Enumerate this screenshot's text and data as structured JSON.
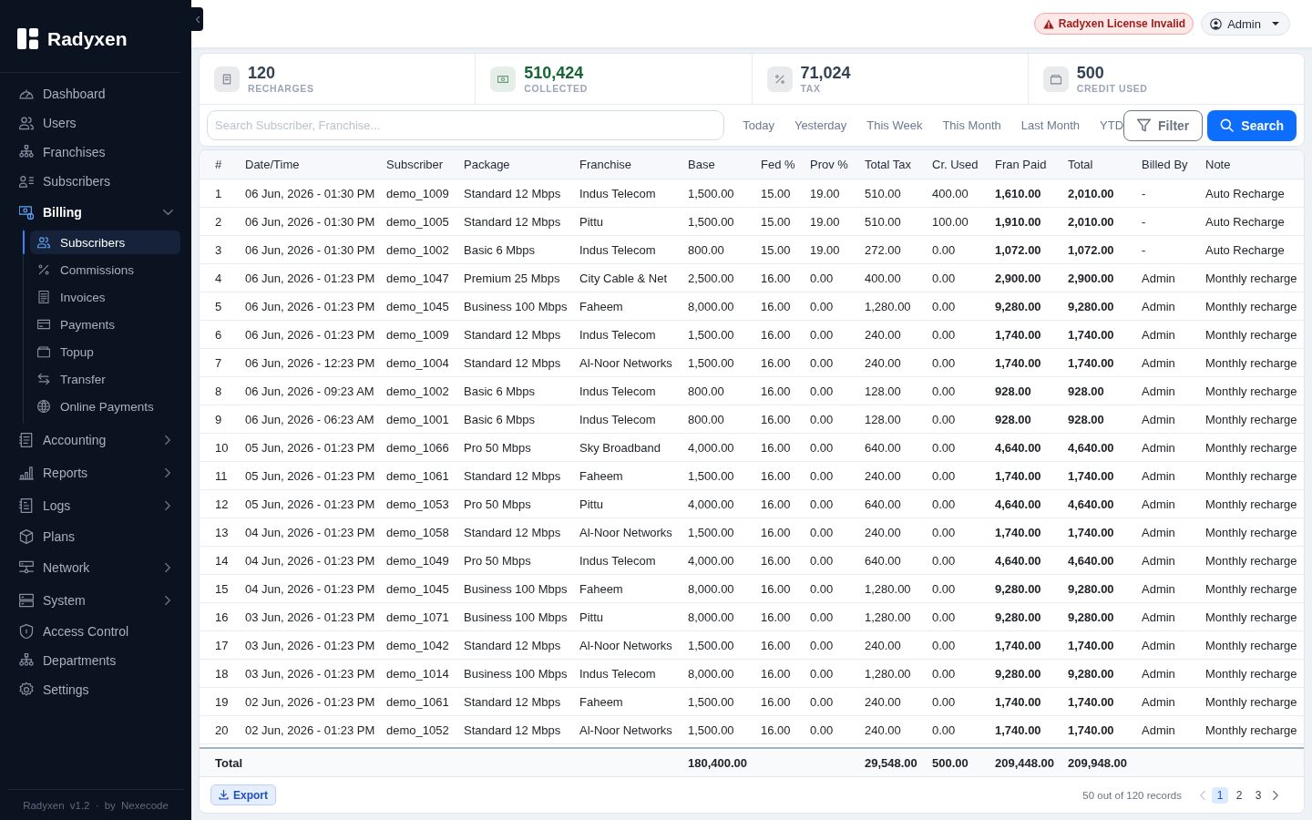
{
  "sidebar": {
    "brand": "Radyxen",
    "items": [
      {
        "label": "Dashboard",
        "kind": "link",
        "selected": false
      },
      {
        "label": "Users",
        "kind": "link",
        "selected": false
      },
      {
        "label": "Franchises",
        "kind": "link",
        "selected": false
      },
      {
        "label": "Subscribers",
        "kind": "link",
        "selected": false
      },
      {
        "label": "Billing",
        "kind": "group",
        "selected": true,
        "expanded": true,
        "children": [
          {
            "label": "Subscribers",
            "selected": true
          },
          {
            "label": "Commissions",
            "selected": false
          },
          {
            "label": "Invoices",
            "selected": false
          },
          {
            "label": "Payments",
            "selected": false
          },
          {
            "label": "Topup",
            "selected": false
          },
          {
            "label": "Transfer",
            "selected": false
          },
          {
            "label": "Online Payments",
            "selected": false
          }
        ]
      },
      {
        "label": "Accounting",
        "kind": "group",
        "selected": false,
        "expanded": false
      },
      {
        "label": "Reports",
        "kind": "group",
        "selected": false,
        "expanded": false
      },
      {
        "label": "Logs",
        "kind": "group",
        "selected": false,
        "expanded": false
      },
      {
        "label": "Plans",
        "kind": "link",
        "selected": false
      },
      {
        "label": "Network",
        "kind": "group",
        "selected": false,
        "expanded": false
      },
      {
        "label": "System",
        "kind": "group",
        "selected": false,
        "expanded": false
      },
      {
        "label": "Access Control",
        "kind": "link",
        "selected": false
      },
      {
        "label": "Departments",
        "kind": "link",
        "selected": false
      },
      {
        "label": "Settings",
        "kind": "link",
        "selected": false
      }
    ],
    "footer": "Radyxen v1.2 · by Nexecode"
  },
  "top_bar": {
    "alert": "Radyxen License Invalid",
    "user_menu": "Admin"
  },
  "stats": [
    {
      "value": "120",
      "label": "RECHARGES",
      "color": "#334155"
    },
    {
      "value": "510,424",
      "label": "COLLECTED",
      "color": "#166534"
    },
    {
      "value": "71,024",
      "label": "TAX",
      "color": "#334155"
    },
    {
      "value": "500",
      "label": "CREDIT USED",
      "color": "#334155"
    }
  ],
  "filters": {
    "search": {
      "placeholder": "Search Subscriber, Franchise..."
    },
    "date_ranges": [
      {
        "label": "Today",
        "selected": false
      },
      {
        "label": "Yesterday",
        "selected": false
      },
      {
        "label": "This Week",
        "selected": false
      },
      {
        "label": "This Month",
        "selected": false
      },
      {
        "label": "Last Month",
        "selected": false
      },
      {
        "label": "YTD",
        "selected": false
      }
    ],
    "filter_button": "Filter",
    "search_button": "Search"
  },
  "table": {
    "columns": [
      "#",
      "Date/Time",
      "Subscriber",
      "Package",
      "Franchise",
      "Base",
      "Fed %",
      "Prov %",
      "Total Tax",
      "Cr. Used",
      "Fran Paid",
      "Total",
      "Billed By",
      "Note"
    ],
    "rows": [
      [
        "1",
        "06 Jun, 2026 - 01:30 PM",
        "demo_1009",
        "Standard 12 Mbps",
        "Indus Telecom",
        "1,500.00",
        "15.00",
        "19.00",
        "510.00",
        "400.00",
        "1,610.00",
        "2,010.00",
        "-",
        "Auto Recharge"
      ],
      [
        "2",
        "06 Jun, 2026 - 01:30 PM",
        "demo_1005",
        "Standard 12 Mbps",
        "Pittu",
        "1,500.00",
        "15.00",
        "19.00",
        "510.00",
        "100.00",
        "1,910.00",
        "2,010.00",
        "-",
        "Auto Recharge"
      ],
      [
        "3",
        "06 Jun, 2026 - 01:30 PM",
        "demo_1002",
        "Basic 6 Mbps",
        "Indus Telecom",
        "800.00",
        "15.00",
        "19.00",
        "272.00",
        "0.00",
        "1,072.00",
        "1,072.00",
        "-",
        "Auto Recharge"
      ],
      [
        "4",
        "06 Jun, 2026 - 01:23 PM",
        "demo_1047",
        "Premium 25 Mbps",
        "City Cable & Net",
        "2,500.00",
        "16.00",
        "0.00",
        "400.00",
        "0.00",
        "2,900.00",
        "2,900.00",
        "Admin",
        "Monthly recharge"
      ],
      [
        "5",
        "06 Jun, 2026 - 01:23 PM",
        "demo_1045",
        "Business 100 Mbps",
        "Faheem",
        "8,000.00",
        "16.00",
        "0.00",
        "1,280.00",
        "0.00",
        "9,280.00",
        "9,280.00",
        "Admin",
        "Monthly recharge"
      ],
      [
        "6",
        "06 Jun, 2026 - 01:23 PM",
        "demo_1009",
        "Standard 12 Mbps",
        "Indus Telecom",
        "1,500.00",
        "16.00",
        "0.00",
        "240.00",
        "0.00",
        "1,740.00",
        "1,740.00",
        "Admin",
        "Monthly recharge"
      ],
      [
        "7",
        "06 Jun, 2026 - 12:23 PM",
        "demo_1004",
        "Standard 12 Mbps",
        "Al-Noor Networks",
        "1,500.00",
        "16.00",
        "0.00",
        "240.00",
        "0.00",
        "1,740.00",
        "1,740.00",
        "Admin",
        "Monthly recharge"
      ],
      [
        "8",
        "06 Jun, 2026 - 09:23 AM",
        "demo_1002",
        "Basic 6 Mbps",
        "Indus Telecom",
        "800.00",
        "16.00",
        "0.00",
        "128.00",
        "0.00",
        "928.00",
        "928.00",
        "Admin",
        "Monthly recharge"
      ],
      [
        "9",
        "06 Jun, 2026 - 06:23 AM",
        "demo_1001",
        "Basic 6 Mbps",
        "Indus Telecom",
        "800.00",
        "16.00",
        "0.00",
        "128.00",
        "0.00",
        "928.00",
        "928.00",
        "Admin",
        "Monthly recharge"
      ],
      [
        "10",
        "05 Jun, 2026 - 01:23 PM",
        "demo_1066",
        "Pro 50 Mbps",
        "Sky Broadband",
        "4,000.00",
        "16.00",
        "0.00",
        "640.00",
        "0.00",
        "4,640.00",
        "4,640.00",
        "Admin",
        "Monthly recharge"
      ],
      [
        "11",
        "05 Jun, 2026 - 01:23 PM",
        "demo_1061",
        "Standard 12 Mbps",
        "Faheem",
        "1,500.00",
        "16.00",
        "0.00",
        "240.00",
        "0.00",
        "1,740.00",
        "1,740.00",
        "Admin",
        "Monthly recharge"
      ],
      [
        "12",
        "05 Jun, 2026 - 01:23 PM",
        "demo_1053",
        "Pro 50 Mbps",
        "Pittu",
        "4,000.00",
        "16.00",
        "0.00",
        "640.00",
        "0.00",
        "4,640.00",
        "4,640.00",
        "Admin",
        "Monthly recharge"
      ],
      [
        "13",
        "04 Jun, 2026 - 01:23 PM",
        "demo_1058",
        "Standard 12 Mbps",
        "Al-Noor Networks",
        "1,500.00",
        "16.00",
        "0.00",
        "240.00",
        "0.00",
        "1,740.00",
        "1,740.00",
        "Admin",
        "Monthly recharge"
      ],
      [
        "14",
        "04 Jun, 2026 - 01:23 PM",
        "demo_1049",
        "Pro 50 Mbps",
        "Indus Telecom",
        "4,000.00",
        "16.00",
        "0.00",
        "640.00",
        "0.00",
        "4,640.00",
        "4,640.00",
        "Admin",
        "Monthly recharge"
      ],
      [
        "15",
        "04 Jun, 2026 - 01:23 PM",
        "demo_1045",
        "Business 100 Mbps",
        "Faheem",
        "8,000.00",
        "16.00",
        "0.00",
        "1,280.00",
        "0.00",
        "9,280.00",
        "9,280.00",
        "Admin",
        "Monthly recharge"
      ],
      [
        "16",
        "03 Jun, 2026 - 01:23 PM",
        "demo_1071",
        "Business 100 Mbps",
        "Pittu",
        "8,000.00",
        "16.00",
        "0.00",
        "1,280.00",
        "0.00",
        "9,280.00",
        "9,280.00",
        "Admin",
        "Monthly recharge"
      ],
      [
        "17",
        "03 Jun, 2026 - 01:23 PM",
        "demo_1042",
        "Standard 12 Mbps",
        "Al-Noor Networks",
        "1,500.00",
        "16.00",
        "0.00",
        "240.00",
        "0.00",
        "1,740.00",
        "1,740.00",
        "Admin",
        "Monthly recharge"
      ],
      [
        "18",
        "03 Jun, 2026 - 01:23 PM",
        "demo_1014",
        "Business 100 Mbps",
        "Indus Telecom",
        "8,000.00",
        "16.00",
        "0.00",
        "1,280.00",
        "0.00",
        "9,280.00",
        "9,280.00",
        "Admin",
        "Monthly recharge"
      ],
      [
        "19",
        "02 Jun, 2026 - 01:23 PM",
        "demo_1061",
        "Standard 12 Mbps",
        "Faheem",
        "1,500.00",
        "16.00",
        "0.00",
        "240.00",
        "0.00",
        "1,740.00",
        "1,740.00",
        "Admin",
        "Monthly recharge"
      ],
      [
        "20",
        "02 Jun, 2026 - 01:23 PM",
        "demo_1052",
        "Standard 12 Mbps",
        "Al-Noor Networks",
        "1,500.00",
        "16.00",
        "0.00",
        "240.00",
        "0.00",
        "1,740.00",
        "1,740.00",
        "Admin",
        "Monthly recharge"
      ]
    ],
    "totals": {
      "label": "Total",
      "base": "180,400.00",
      "total_tax": "29,548.00",
      "cr_used": "500.00",
      "fran_paid": "209,448.00",
      "total": "209,948.00"
    },
    "export_button": "Export",
    "pagination": {
      "summary": "50 out of 120 records",
      "previous_disabled": true,
      "next_disabled": false,
      "pages": [
        {
          "label": "1",
          "selected": true
        },
        {
          "label": "2",
          "selected": false
        },
        {
          "label": "3",
          "selected": false
        }
      ]
    }
  }
}
